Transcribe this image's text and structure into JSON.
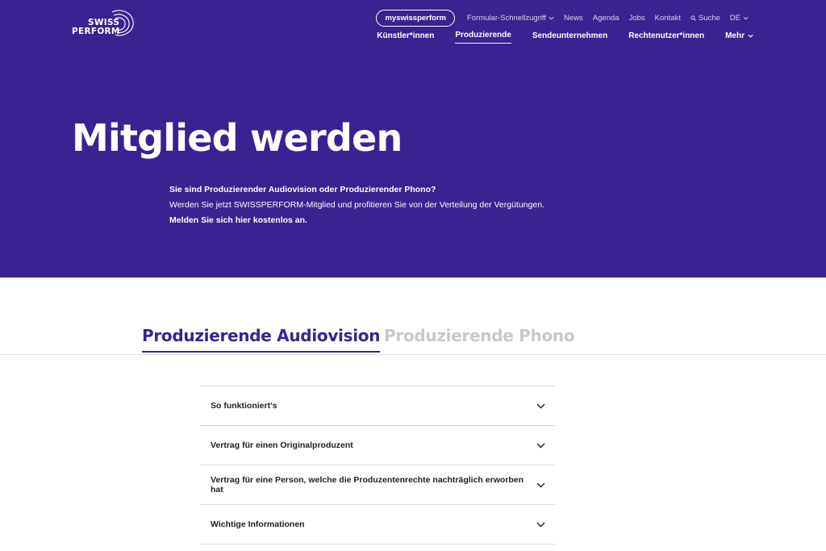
{
  "brand": {
    "line1": "SWISS",
    "line2": "PERFORM"
  },
  "topnav": {
    "account": "myswissperform",
    "items": [
      "Formular-Schnellzugriff",
      "News",
      "Agenda",
      "Jobs",
      "Kontakt"
    ],
    "search": "Suche",
    "language": "DE"
  },
  "mainnav": {
    "items": [
      "Künstler*innen",
      "Produzierende",
      "Sendeunternehmen",
      "Rechtenutzer*innen"
    ],
    "more": "Mehr",
    "active": "Produzierende"
  },
  "hero": {
    "title": "Mitglied werden",
    "intro_bold": "Sie sind Produzierender Audiovision oder Produzierender Phono?",
    "intro_text": "Werden Sie jetzt SWISSPERFORM-Mitglied und profitieren Sie von der Verteilung der Vergütungen.",
    "intro_cta": "Melden Sie sich hier kostenlos an."
  },
  "tabs": [
    "Produzierende Audiovision",
    "Produzierende Phono"
  ],
  "accordion": [
    "So funktioniert's",
    "Vertrag für einen Originalproduzent",
    "Vertrag für eine Person, welche die Produzentenrechte nachträglich erworben hat",
    "Wichtige Informationen"
  ],
  "colors": {
    "brand": "#3a2390",
    "text": "#1f1f1f",
    "inactive_tab": "#c9c9c9"
  }
}
